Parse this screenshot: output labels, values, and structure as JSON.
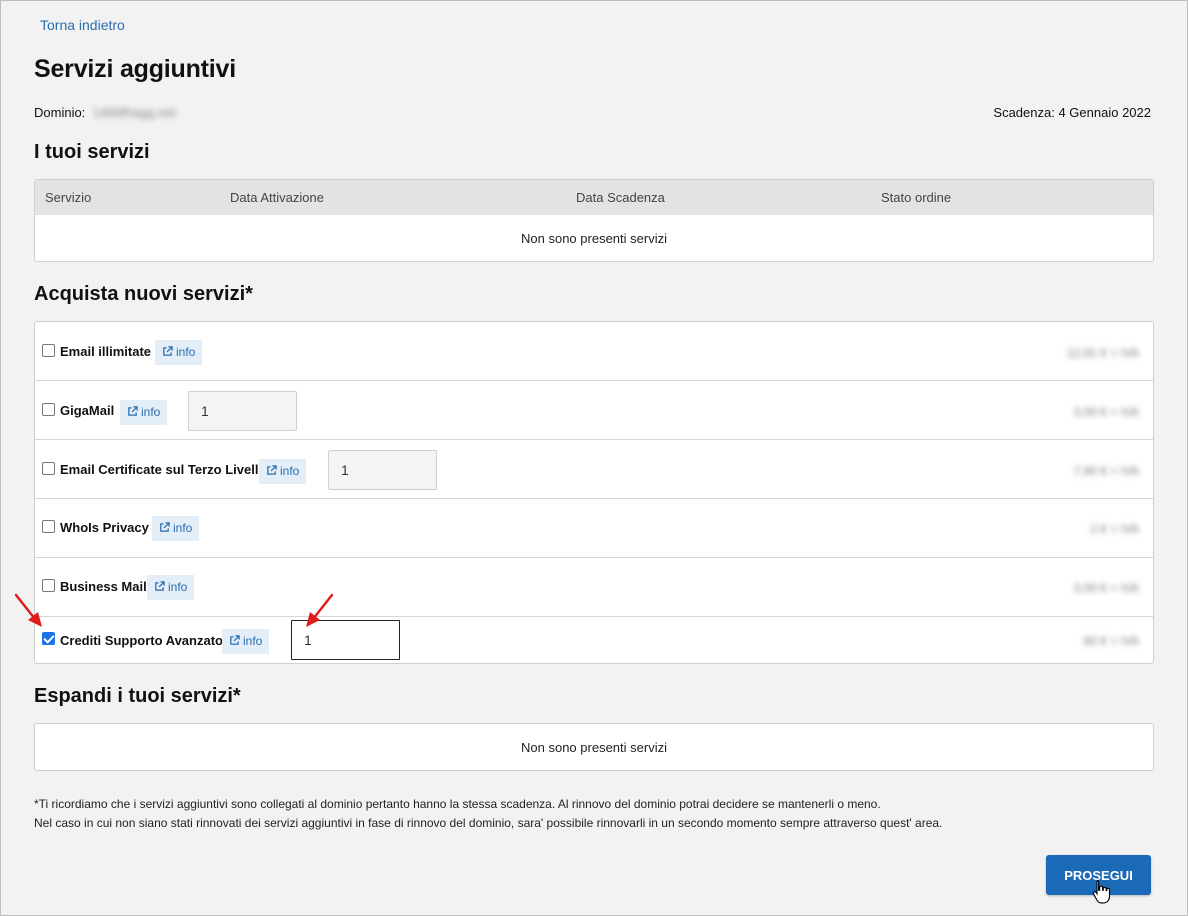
{
  "nav": {
    "back_label": "Torna indietro"
  },
  "page": {
    "title": "Servizi aggiuntivi",
    "domain_label": "Dominio:",
    "domain_value": "1469fhagg.net",
    "expiry_label": "Scadenza:",
    "expiry_value": "4 Gennaio 2022"
  },
  "your_services": {
    "title": "I tuoi servizi",
    "columns": [
      "Servizio",
      "Data Attivazione",
      "Data Scadenza",
      "Stato ordine"
    ],
    "empty_message": "Non sono presenti servizi"
  },
  "buy_services": {
    "title": "Acquista nuovi servizi*",
    "info_label": "info",
    "items": [
      {
        "name": "Email illimitate",
        "checked": false,
        "quantity": null,
        "price": "12,91 € + IVA"
      },
      {
        "name": "GigaMail",
        "checked": false,
        "quantity": "1",
        "price": "3,00 € + IVA"
      },
      {
        "name": "Email Certificate sul Terzo Livello",
        "checked": false,
        "quantity": "1",
        "price": "7,90 € + IVA"
      },
      {
        "name": "WhoIs Privacy",
        "checked": false,
        "quantity": null,
        "price": "2 € + IVA"
      },
      {
        "name": "Business Mail",
        "checked": false,
        "quantity": null,
        "price": "3,00 € + IVA"
      },
      {
        "name": "Crediti Supporto Avanzato",
        "checked": true,
        "quantity": "1",
        "price": "60 € + IVA"
      }
    ]
  },
  "expand_services": {
    "title": "Espandi i tuoi servizi*",
    "empty_message": "Non sono presenti servizi"
  },
  "footnote": {
    "line1": "*Ti ricordiamo che i servizi aggiuntivi sono collegati al dominio pertanto hanno la stessa scadenza. Al rinnovo del dominio potrai decidere se mantenerli o meno.",
    "line2": "Nel caso in cui non siano stati rinnovati dei servizi aggiuntivi in fase di rinnovo del dominio, sara' possibile rinnovarli in un secondo momento sempre attraverso quest' area."
  },
  "actions": {
    "proceed_label": "PROSEGUI"
  },
  "colors": {
    "accent": "#1b6ab8",
    "link": "#2a6db0",
    "annotation_arrow": "#e01b1b"
  }
}
